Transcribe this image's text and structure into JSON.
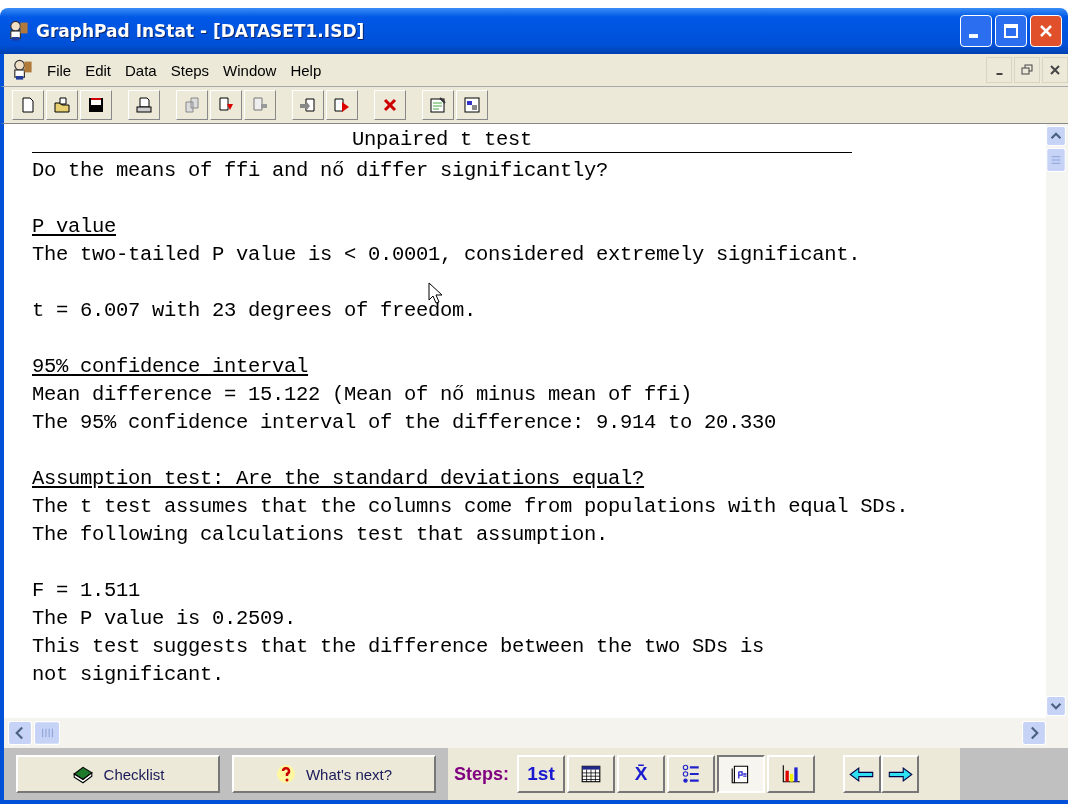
{
  "window": {
    "title": "GraphPad InStat - [DATASET1.ISD]"
  },
  "menu": [
    "File",
    "Edit",
    "Data",
    "Steps",
    "Window",
    "Help"
  ],
  "results": [
    {
      "kind": "heading",
      "text": "Unpaired t test"
    },
    {
      "kind": "text",
      "text": "Do the means of ffi and nő differ significantly?"
    },
    {
      "kind": "blank"
    },
    {
      "kind": "subheading",
      "text": "P value"
    },
    {
      "kind": "text",
      "text": "The two-tailed P value is < 0.0001, considered extremely significant."
    },
    {
      "kind": "blank"
    },
    {
      "kind": "text",
      "text": "t = 6.007 with 23 degrees of freedom."
    },
    {
      "kind": "blank"
    },
    {
      "kind": "subheading",
      "text": "95% confidence interval"
    },
    {
      "kind": "text",
      "text": "Mean difference = 15.122 (Mean of nő minus mean of ffi)"
    },
    {
      "kind": "text",
      "text": "The 95% confidence interval of the difference: 9.914 to 20.330"
    },
    {
      "kind": "blank"
    },
    {
      "kind": "subheading",
      "text": "Assumption test: Are the standard deviations equal?"
    },
    {
      "kind": "text",
      "text": "The t test assumes that the columns come from populations with equal SDs."
    },
    {
      "kind": "text",
      "text": "The following calculations test that assumption."
    },
    {
      "kind": "blank"
    },
    {
      "kind": "text",
      "text": "F = 1.511"
    },
    {
      "kind": "text",
      "text": "The P value is 0.2509."
    },
    {
      "kind": "text",
      "text": "This test suggests that the difference between the two SDs is"
    },
    {
      "kind": "text",
      "text": "not significant."
    }
  ],
  "bottom_bar": {
    "checklist": "Checklist",
    "whats_next": "What's next?",
    "steps_label": "Steps:",
    "steps": [
      {
        "kind": "text",
        "text": "1st",
        "selected": false
      },
      {
        "kind": "table",
        "selected": false
      },
      {
        "kind": "text",
        "text": "X̄",
        "selected": false
      },
      {
        "kind": "list",
        "selected": false
      },
      {
        "kind": "results",
        "selected": true
      },
      {
        "kind": "graph",
        "selected": false
      }
    ]
  }
}
